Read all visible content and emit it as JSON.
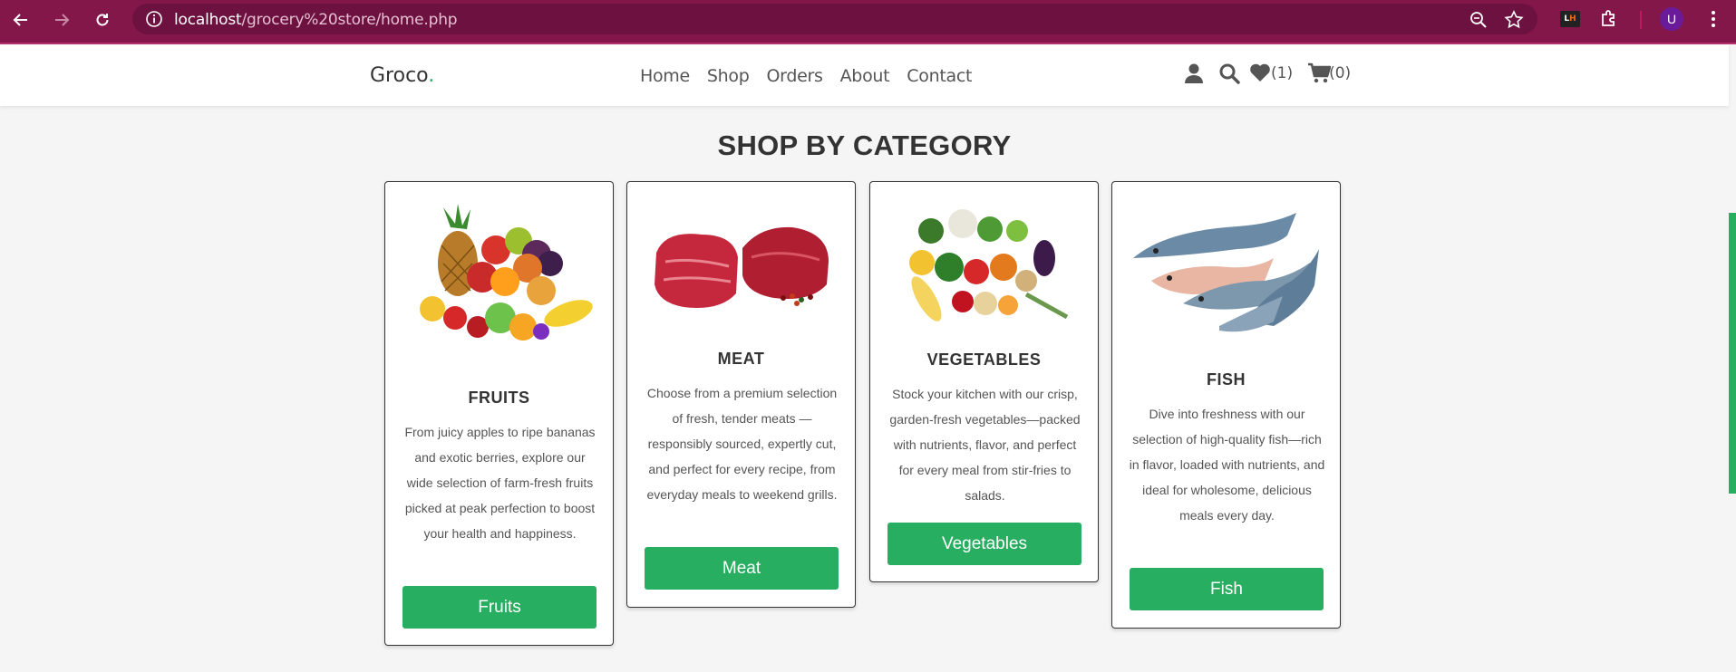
{
  "browser": {
    "url_host": "localhost",
    "url_path": "/grocery%20store/home.php",
    "extension_label_l": "L",
    "extension_label_h": "H",
    "profile_initial": "U"
  },
  "header": {
    "logo_text": "Groco",
    "logo_dot": ".",
    "nav": [
      "Home",
      "Shop",
      "Orders",
      "About",
      "Contact"
    ],
    "wishlist_count": "(1)",
    "cart_count": "(0)"
  },
  "section": {
    "title": "SHOP BY CATEGORY"
  },
  "categories": [
    {
      "name": "FRUITS",
      "description": "From juicy apples to ripe bananas and exotic berries, explore our wide selection of farm-fresh fruits picked at peak perfection to boost your health and happiness.",
      "button": "Fruits",
      "image": "fruits-image"
    },
    {
      "name": "MEAT",
      "description": "Choose from a premium selection of fresh, tender meats — responsibly sourced, expertly cut, and perfect for every recipe, from everyday meals to weekend grills.",
      "button": "Meat",
      "image": "meat-image"
    },
    {
      "name": "VEGETABLES",
      "description": "Stock your kitchen with our crisp, garden-fresh vegetables—packed with nutrients, flavor, and perfect for every meal from stir-fries to salads.",
      "button": "Vegetables",
      "image": "vegetables-image"
    },
    {
      "name": "FISH",
      "description": "Dive into freshness with our selection of high-quality fish—rich in flavor, loaded with nutrients, and ideal for wholesome, delicious meals every day.",
      "button": "Fish",
      "image": "fish-image"
    }
  ],
  "colors": {
    "chrome": "#84174a",
    "accent": "#27ae60"
  }
}
